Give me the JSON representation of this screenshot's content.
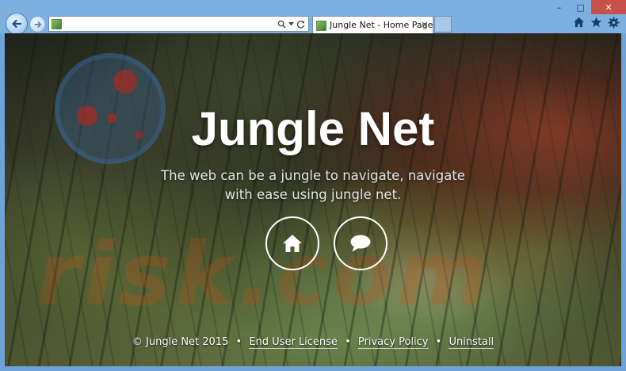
{
  "browser": {
    "address_value": "",
    "tab_title": "Jungle Net - Home Page",
    "tab_close": "×",
    "window_controls": {
      "minimize": "–",
      "maximize": "□",
      "close": "✕"
    }
  },
  "icons": {
    "back": "arrow-left-icon",
    "forward": "arrow-right-icon",
    "search": "magnifier-icon",
    "dropdown": "chevron-down-icon",
    "refresh": "refresh-icon",
    "home": "home-icon",
    "favorites": "star-icon",
    "settings": "gear-icon",
    "hero_home": "home-icon",
    "hero_chat": "speech-bubble-icon"
  },
  "page": {
    "title": "Jungle Net",
    "tagline": "The web can be a jungle to navigate, navigate with ease using jungle net.",
    "footer": {
      "copyright": "© Jungle Net 2015",
      "links": [
        "End User License",
        "Privacy Policy",
        "Uninstall"
      ],
      "separator": "•"
    }
  },
  "colors": {
    "chrome": "#7db0e0",
    "close_button": "#c7504a",
    "title_text": "#ffffff"
  }
}
